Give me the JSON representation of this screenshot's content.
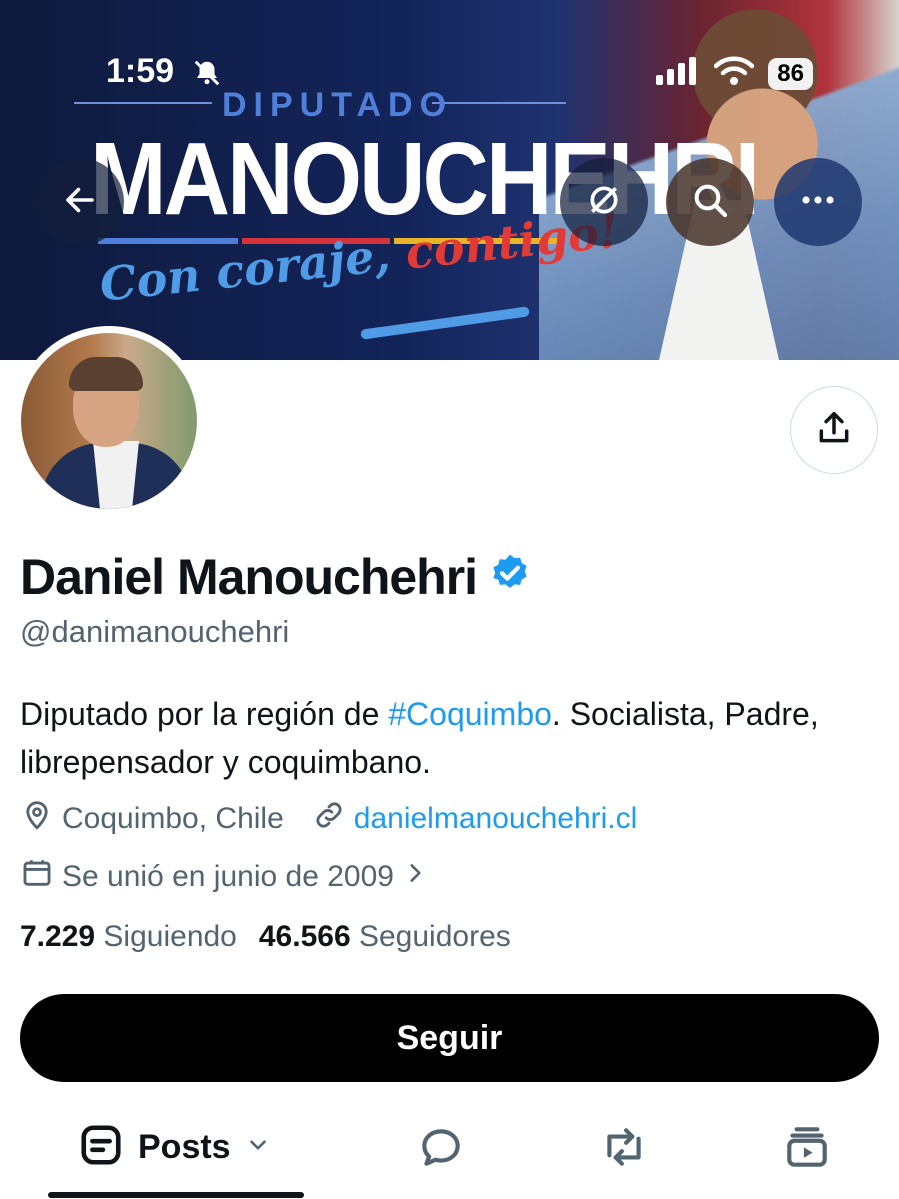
{
  "status_bar": {
    "time": "1:59",
    "battery": "86"
  },
  "banner": {
    "kicker": "DIPUTADO",
    "name": "MANOUCHEHRI",
    "slogan_part1": "Con coraje, ",
    "slogan_part2": "contigo!"
  },
  "profile": {
    "display_name": "Daniel Manouchehri",
    "handle": "@danimanouchehri",
    "bio_before": "Diputado por la región de ",
    "bio_hashtag": "#Coquimbo",
    "bio_after": ". Socialista, Padre, librepensador y coquimbano.",
    "location": "Coquimbo, Chile",
    "website": "danielmanouchehri.cl",
    "joined": "Se unió en junio de 2009",
    "following_count": "7.229",
    "following_label": "Siguiendo",
    "followers_count": "46.566",
    "followers_label": "Seguidores"
  },
  "actions": {
    "follow": "Seguir"
  },
  "tabs": {
    "posts": "Posts"
  },
  "colors": {
    "accent": "#1d9bf0",
    "text": "#0f1419",
    "muted": "#536471",
    "verified": "#1d9bf0"
  }
}
